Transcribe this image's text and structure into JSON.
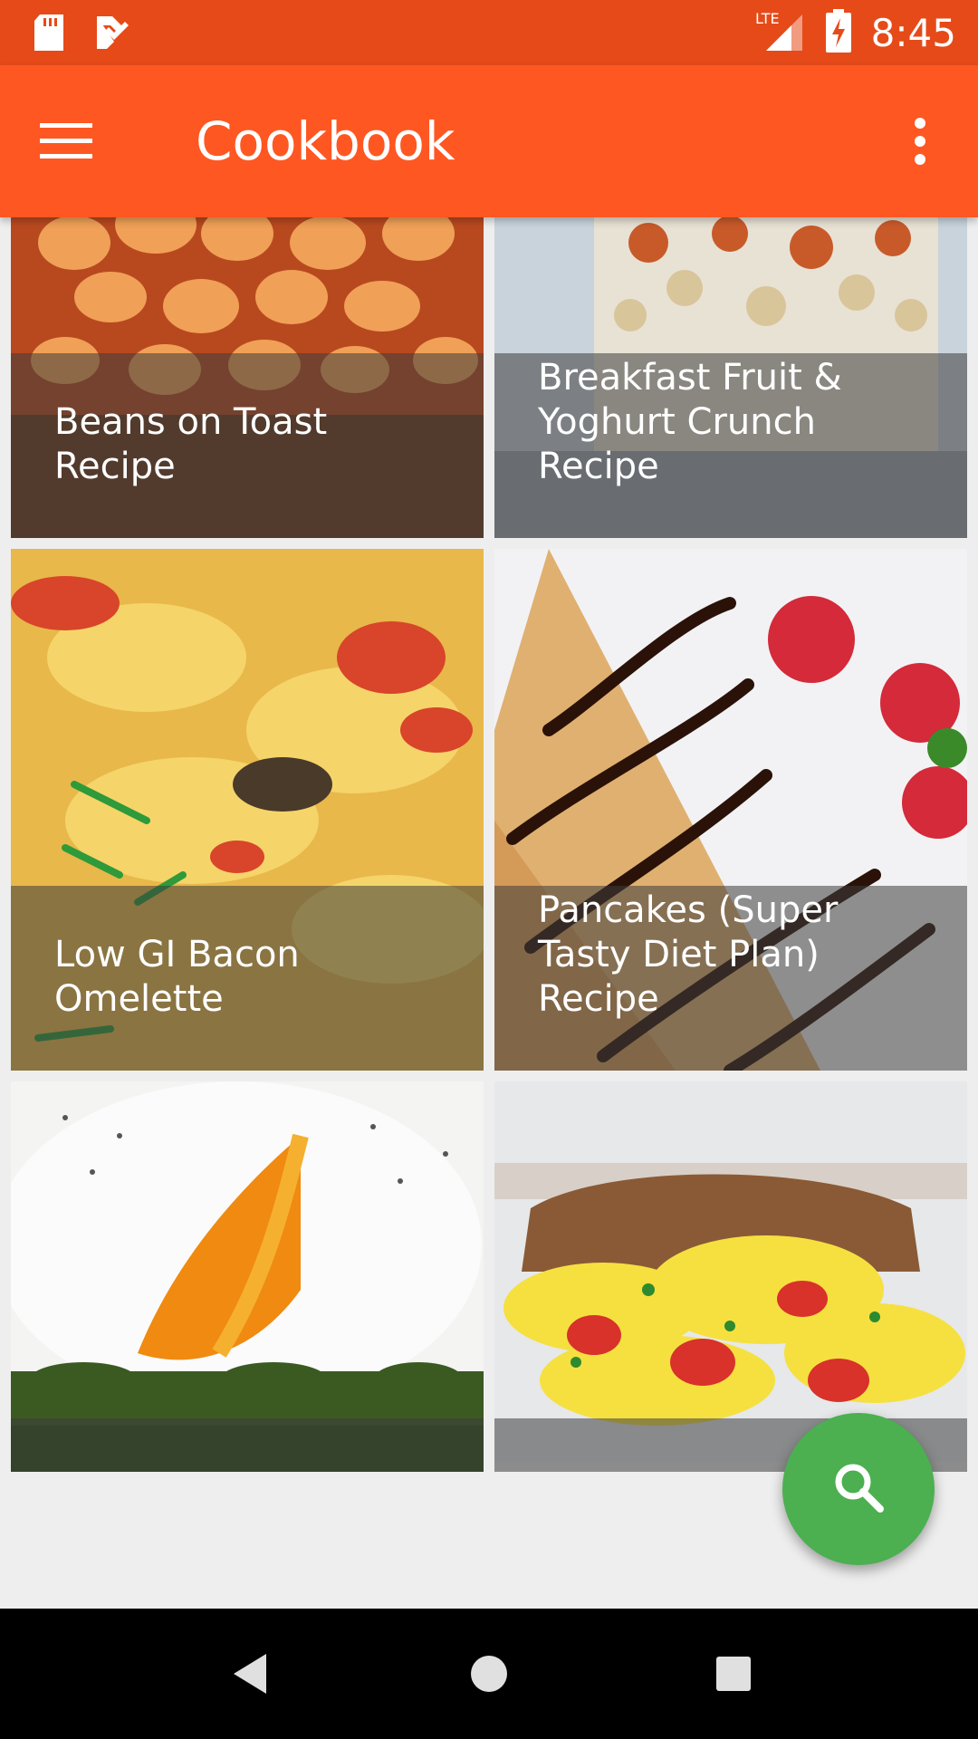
{
  "status_bar": {
    "time": "8:45",
    "network": "LTE",
    "icons": [
      "sd-card-icon",
      "tasks-check-icon",
      "lte-signal-icon",
      "battery-charging-icon"
    ]
  },
  "app_bar": {
    "title": "Cookbook",
    "menu_icon": "hamburger-menu-icon",
    "overflow_icon": "more-vert-icon"
  },
  "recipes": [
    {
      "title": "Beans on Toast Recipe"
    },
    {
      "title": "Breakfast Fruit & Yoghurt Crunch Recipe"
    },
    {
      "title": "Low GI Bacon Omelette"
    },
    {
      "title": "Pancakes (Super Tasty Diet Plan) Recipe"
    },
    {
      "title": ""
    },
    {
      "title": ""
    }
  ],
  "fab": {
    "icon": "search-icon",
    "color": "#4caf50"
  },
  "nav_bar": {
    "icons": [
      "back-icon",
      "home-icon",
      "recents-icon"
    ]
  },
  "colors": {
    "status_bar": "#e64a19",
    "app_bar": "#ff5722",
    "background": "#eeeeee"
  }
}
